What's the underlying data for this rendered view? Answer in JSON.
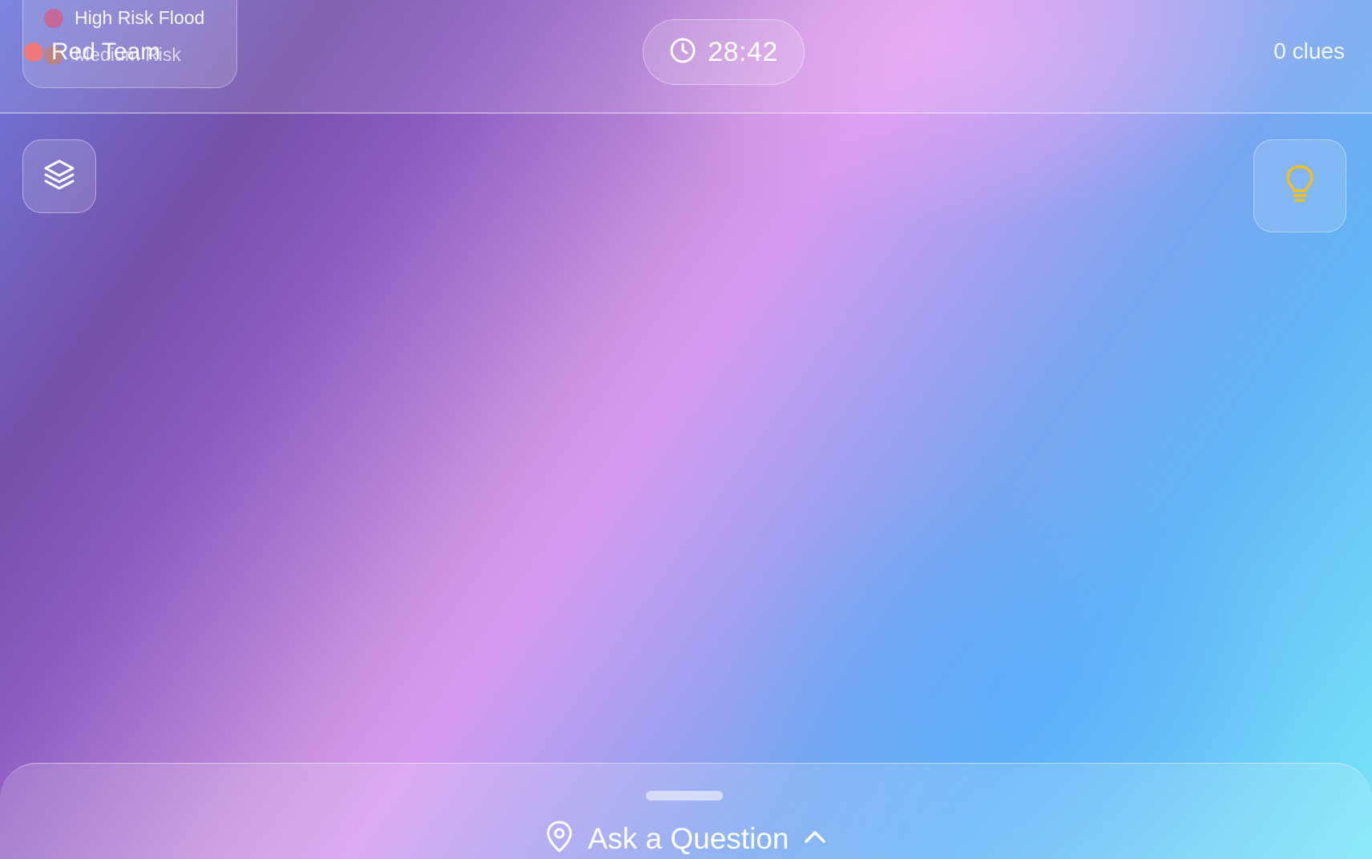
{
  "header": {
    "legend": [
      {
        "label": "High Risk Flood",
        "color": "#c46a9a"
      },
      {
        "label": "Medium Risk",
        "color": "#c8806e"
      }
    ],
    "team": {
      "label": "Red Team",
      "color": "#f07a7a"
    },
    "timer": {
      "value": "28:42",
      "icon": "clock-icon"
    },
    "clues": "0 clues"
  },
  "controls": {
    "layers_icon": "layers-icon",
    "hint_icon": "lightbulb-icon",
    "hint_color": "#f0c020"
  },
  "bottom_sheet": {
    "label": "Ask a Question",
    "leading_icon": "map-pin-icon",
    "trailing_icon": "chevron-up-icon"
  }
}
